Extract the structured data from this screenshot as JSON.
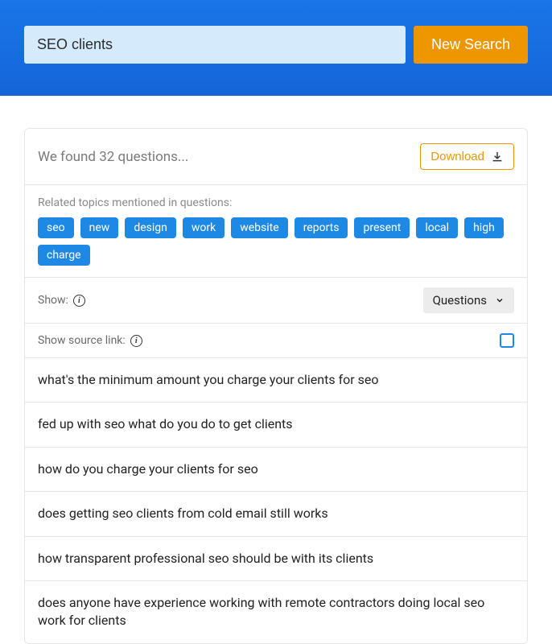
{
  "header": {
    "search_value": "SEO clients",
    "new_search_label": "New Search"
  },
  "results": {
    "found_text": "We found 32 questions...",
    "download_label": "Download",
    "related_label": "Related topics mentioned in questions:",
    "tags": [
      "seo",
      "new",
      "design",
      "work",
      "website",
      "reports",
      "present",
      "local",
      "high",
      "charge"
    ],
    "show_label": "Show:",
    "dropdown_value": "Questions",
    "source_label": "Show source link:",
    "questions": [
      "what's the minimum amount you charge your clients for seo",
      "fed up with seo what do you do to get clients",
      "how do you charge your clients for seo",
      "does getting seo clients from cold email still works",
      "how transparent professional seo should be with its clients",
      "does anyone have experience working with remote contractors doing local seo work for clients"
    ]
  }
}
